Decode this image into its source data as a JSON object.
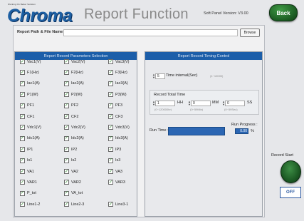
{
  "header": {
    "logo_tagline": "Working On Better Solution",
    "logo_text": "Chroma",
    "title": "Report Function",
    "soft_panel_version": "Soft Panel Version: V3.00",
    "back_label": "Back"
  },
  "path": {
    "label": "Report Path & File Name",
    "value": "",
    "browse_label": "Browse"
  },
  "params": {
    "header": "Report Record Parameters Selection",
    "rows": [
      [
        "Vac1(V)",
        "Vac2(V)",
        "Vac3(V)"
      ],
      [
        "F1(Hz)",
        "F2(Hz)",
        "F3(Hz)"
      ],
      [
        "Iac1(A)",
        "Iac2(A)",
        "Iac3(A)"
      ],
      [
        "P1(W)",
        "P2(W)",
        "P3(W)"
      ],
      [
        "PF1",
        "PF2",
        "PF3"
      ],
      [
        "CF1",
        "CF2",
        "CF3"
      ],
      [
        "Vdc1(V)",
        "Vdc2(V)",
        "Vdc3(V)"
      ],
      [
        "Idc1(A)",
        "Idc2(A)",
        "Idc3(A)"
      ],
      [
        "IP1",
        "IP2",
        "IP3"
      ],
      [
        "Is1",
        "Is2",
        "Is3"
      ],
      [
        "VA1",
        "VA2",
        "VA3"
      ],
      [
        "VAR1",
        "VAR2",
        "VAR3"
      ],
      [
        "P_tot",
        "VA_tot",
        ""
      ],
      [
        "Line1-2",
        "Line2-3",
        "Line3-1"
      ]
    ],
    "check_mark": "✓"
  },
  "timing": {
    "header": "Report Record Timing Control",
    "interval_value": "5",
    "interval_label": "Time interval(Sec)",
    "interval_hint": "(1~10000)",
    "total_label": "Record Total Time",
    "hh_value": "1",
    "hh_label": "HH",
    "hh_hint": "(0~120000hr)",
    "mm_value": "0",
    "mm_label": "MM",
    "mm_hint": "(0~59Min)",
    "ss_value": "0",
    "ss_label": "SS",
    "ss_hint": "(0~59Sec)",
    "run_time_label": "Run Time :",
    "run_progress_label": "Run Progress :",
    "run_progress_value": "0.00",
    "percent_sign": "%"
  },
  "record": {
    "start_label": "Record Start",
    "off_label": "OFF"
  },
  "colors": {
    "accent_blue": "#1c5ea9",
    "button_green": "#1b5b22",
    "check_green": "#2a8a2a"
  }
}
